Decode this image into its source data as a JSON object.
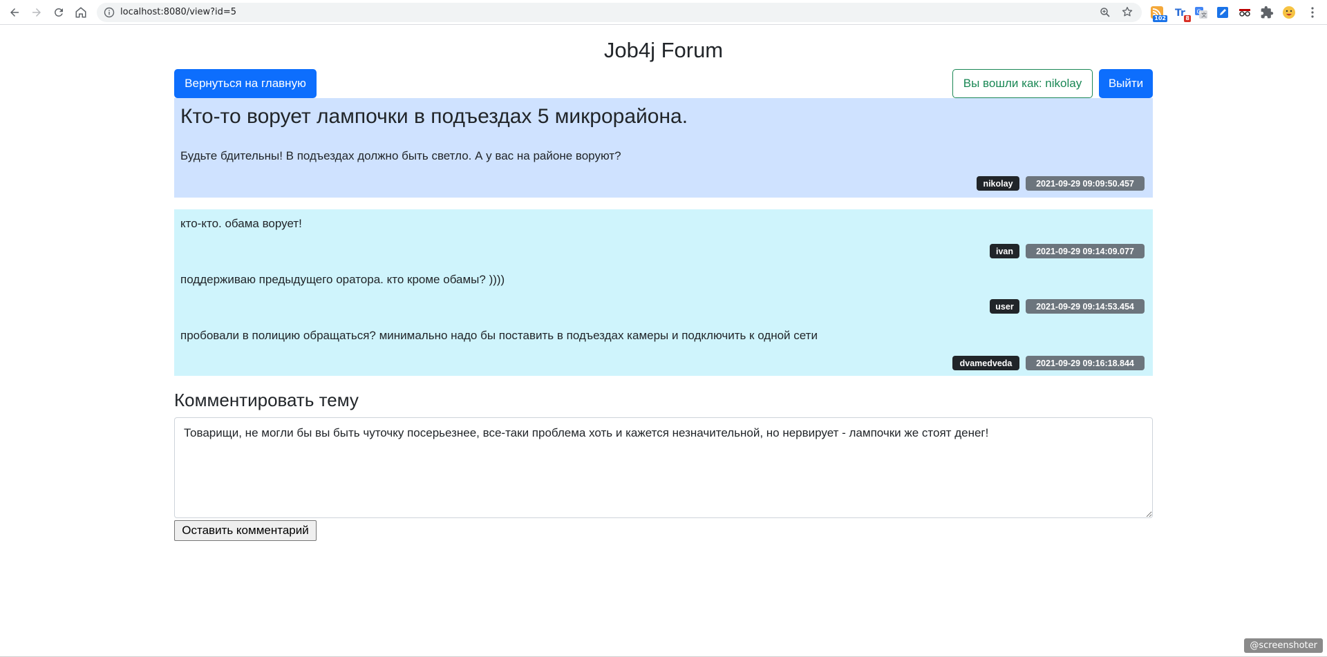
{
  "browser": {
    "url": "localhost:8080/view?id=5",
    "extensions": [
      {
        "icon": "rss-feed-icon",
        "badge": "102",
        "badge_color": "#1a73e8"
      },
      {
        "icon": "translate-app-icon",
        "badge": "8",
        "badge_color": "#d93025"
      },
      {
        "icon": "translate-icon",
        "badge": ""
      },
      {
        "icon": "note-edit-icon",
        "badge": ""
      },
      {
        "icon": "incognito-glasses-icon",
        "badge": ""
      },
      {
        "icon": "puzzle-extensions-icon",
        "badge": ""
      },
      {
        "icon": "profile-avatar-icon",
        "badge": ""
      }
    ]
  },
  "page": {
    "title": "Job4j Forum"
  },
  "header": {
    "back_button": "Вернуться на главную",
    "logged_in_as": "Вы вошли как: nikolay",
    "logout_button": "Выйти"
  },
  "topic": {
    "title": "Кто-то ворует лампочки в подъездах 5 микрорайона.",
    "body": "Будьте бдительны! В подъездах должно быть светло. А у вас на районе воруют?",
    "author": "nikolay",
    "created": "2021-09-29 09:09:50.457"
  },
  "comments": [
    {
      "text": "кто-кто. обама ворует!",
      "author": "ivan",
      "created": "2021-09-29 09:14:09.077"
    },
    {
      "text": "поддерживаю предыдущего оратора. кто кроме обамы? ))))",
      "author": "user",
      "created": "2021-09-29 09:14:53.454"
    },
    {
      "text": "пробовали в полицию обращаться? минимально надо бы поставить в подъездах камеры и подключить к одной сети",
      "author": "dvamedveda",
      "created": "2021-09-29 09:16:18.844"
    }
  ],
  "comment_form": {
    "heading": "Комментировать тему",
    "textarea_value": "Товарищи, не могли бы вы быть чуточку посерьезнее, все-таки проблема хоть и кажется незначительной, но нервирует - лампочки же стоят денег!",
    "submit_label": "Оставить комментарий"
  },
  "watermark": "@screenshoter",
  "colors": {
    "primary": "#0d6efd",
    "success": "#198754",
    "topic_bg": "#cfe2ff",
    "comments_bg": "#cff4fc",
    "badge_dark": "#212529",
    "badge_gray": "#6c757d"
  }
}
